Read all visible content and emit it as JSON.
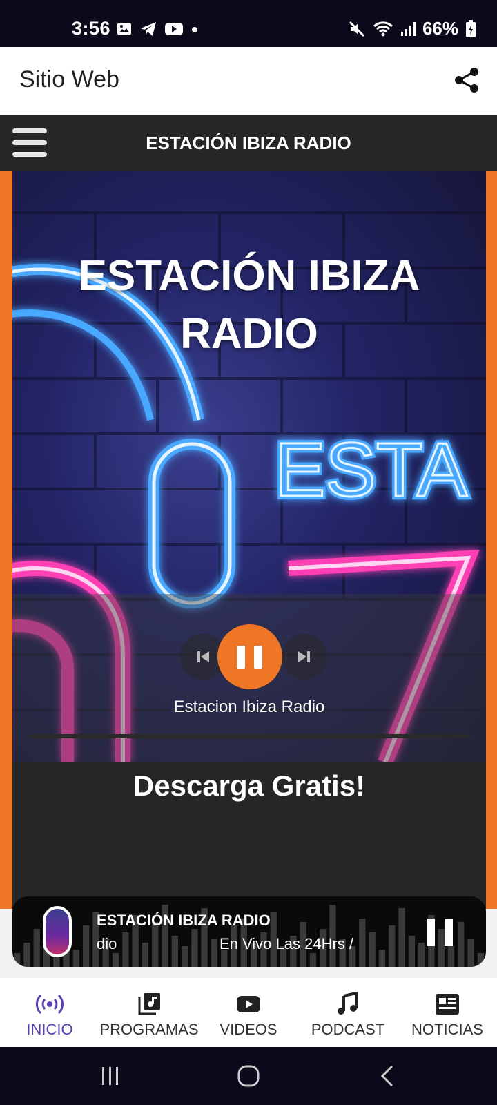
{
  "status_bar": {
    "time": "3:56",
    "battery": "66%"
  },
  "web_bar": {
    "title": "Sitio Web"
  },
  "header": {
    "title": "ESTACIÓN IBIZA RADIO"
  },
  "hero": {
    "title_line1": "ESTACIÓN IBIZA",
    "title_line2": "RADIO",
    "neon_text": "ESTA",
    "station_name": "Estacion Ibiza Radio",
    "progress": 0.0
  },
  "download": {
    "text": "Descarga Gratis!"
  },
  "mini_player": {
    "title": "ESTACIÓN IBIZA RADIO",
    "subtitle_prev": "dio",
    "subtitle": "En Vivo Las 24Hrs /"
  },
  "bottom_nav": {
    "items": [
      {
        "label": "INICIO",
        "icon": "broadcast-icon",
        "active": true
      },
      {
        "label": "PROGRAMAS",
        "icon": "music-library-icon",
        "active": false
      },
      {
        "label": "VIDEOS",
        "icon": "youtube-icon",
        "active": false
      },
      {
        "label": "PODCAST",
        "icon": "music-note-icon",
        "active": false
      },
      {
        "label": "NOTICIAS",
        "icon": "newspaper-icon",
        "active": false
      }
    ]
  },
  "colors": {
    "accent": "#ee7624",
    "active_nav": "#5a3fb5",
    "header_bg": "#262626"
  }
}
